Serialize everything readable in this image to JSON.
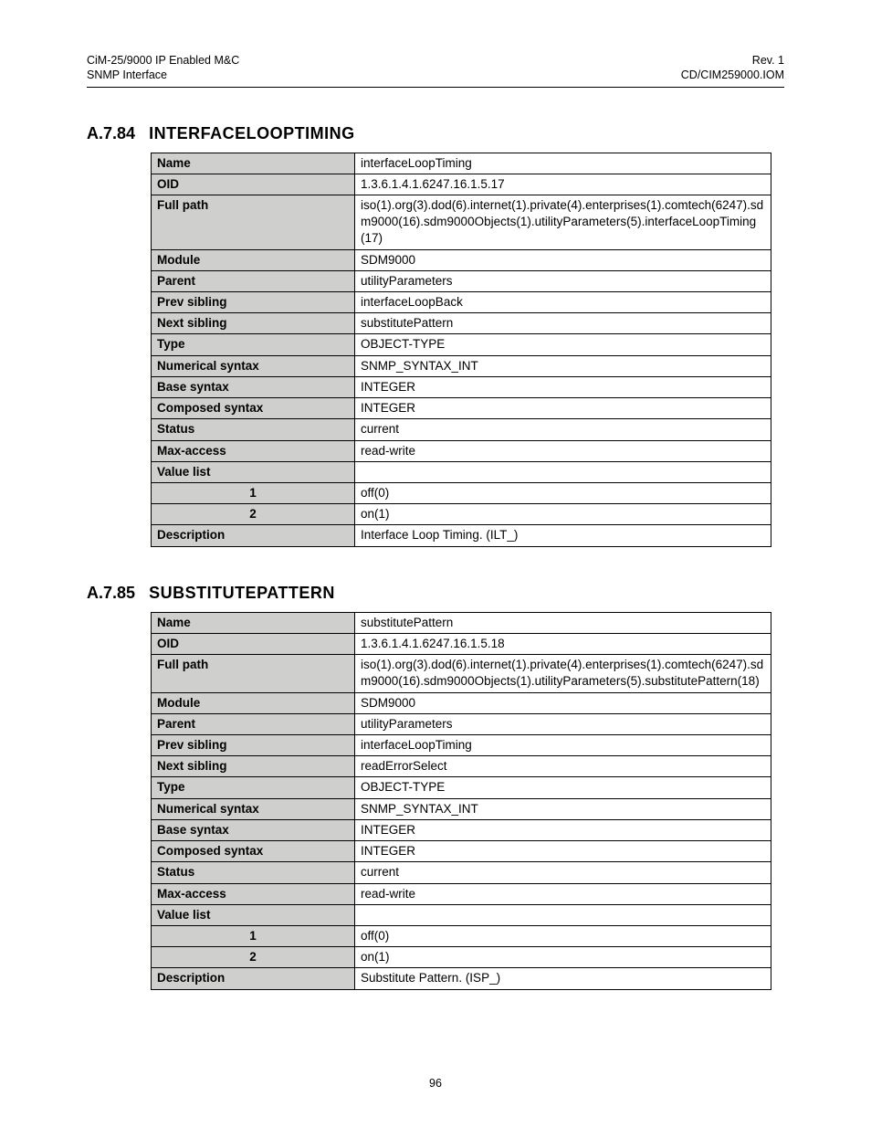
{
  "header": {
    "left_line1": "CiM-25/9000 IP Enabled M&C",
    "left_line2": "SNMP Interface",
    "right_line1": "Rev. 1",
    "right_line2": "CD/CIM259000.IOM"
  },
  "section1": {
    "number": "A.7.84",
    "title": "INTERFACELOOPTIMING",
    "rows": {
      "name_label": "Name",
      "name_value": "interfaceLoopTiming",
      "oid_label": "OID",
      "oid_value": "1.3.6.1.4.1.6247.16.1.5.17",
      "fullpath_label": "Full path",
      "fullpath_value": "iso(1).org(3).dod(6).internet(1).private(4).enterprises(1).comtech(6247).sdm9000(16).sdm9000Objects(1).utilityParameters(5).interfaceLoopTiming(17)",
      "module_label": "Module",
      "module_value": "SDM9000",
      "parent_label": "Parent",
      "parent_value": "utilityParameters",
      "prevsib_label": "Prev sibling",
      "prevsib_value": "interfaceLoopBack",
      "nextsib_label": "Next sibling",
      "nextsib_value": "substitutePattern",
      "type_label": "Type",
      "type_value": "OBJECT-TYPE",
      "numsyn_label": "Numerical syntax",
      "numsyn_value": "SNMP_SYNTAX_INT",
      "basesyn_label": "Base syntax",
      "basesyn_value": "INTEGER",
      "compsyn_label": "Composed syntax",
      "compsyn_value": "INTEGER",
      "status_label": "Status",
      "status_value": "current",
      "maxacc_label": "Max-access",
      "maxacc_value": "read-write",
      "valuelist_label": "Value list",
      "valuelist_value": "",
      "v1_label": "1",
      "v1_value": "off(0)",
      "v2_label": "2",
      "v2_value": "on(1)",
      "desc_label": "Description",
      "desc_value": "Interface Loop Timing.  (ILT_)"
    }
  },
  "section2": {
    "number": "A.7.85",
    "title": "SUBSTITUTEPATTERN",
    "rows": {
      "name_label": "Name",
      "name_value": "substitutePattern",
      "oid_label": "OID",
      "oid_value": "1.3.6.1.4.1.6247.16.1.5.18",
      "fullpath_label": "Full path",
      "fullpath_value": "iso(1).org(3).dod(6).internet(1).private(4).enterprises(1).comtech(6247).sdm9000(16).sdm9000Objects(1).utilityParameters(5).substitutePattern(18)",
      "module_label": "Module",
      "module_value": "SDM9000",
      "parent_label": "Parent",
      "parent_value": "utilityParameters",
      "prevsib_label": "Prev sibling",
      "prevsib_value": "interfaceLoopTiming",
      "nextsib_label": "Next sibling",
      "nextsib_value": "readErrorSelect",
      "type_label": "Type",
      "type_value": "OBJECT-TYPE",
      "numsyn_label": "Numerical syntax",
      "numsyn_value": "SNMP_SYNTAX_INT",
      "basesyn_label": "Base syntax",
      "basesyn_value": "INTEGER",
      "compsyn_label": "Composed syntax",
      "compsyn_value": "INTEGER",
      "status_label": "Status",
      "status_value": "current",
      "maxacc_label": "Max-access",
      "maxacc_value": "read-write",
      "valuelist_label": "Value list",
      "valuelist_value": "",
      "v1_label": "1",
      "v1_value": "off(0)",
      "v2_label": "2",
      "v2_value": "on(1)",
      "desc_label": "Description",
      "desc_value": "Substitute Pattern.  (ISP_)"
    }
  },
  "page_number": "96"
}
